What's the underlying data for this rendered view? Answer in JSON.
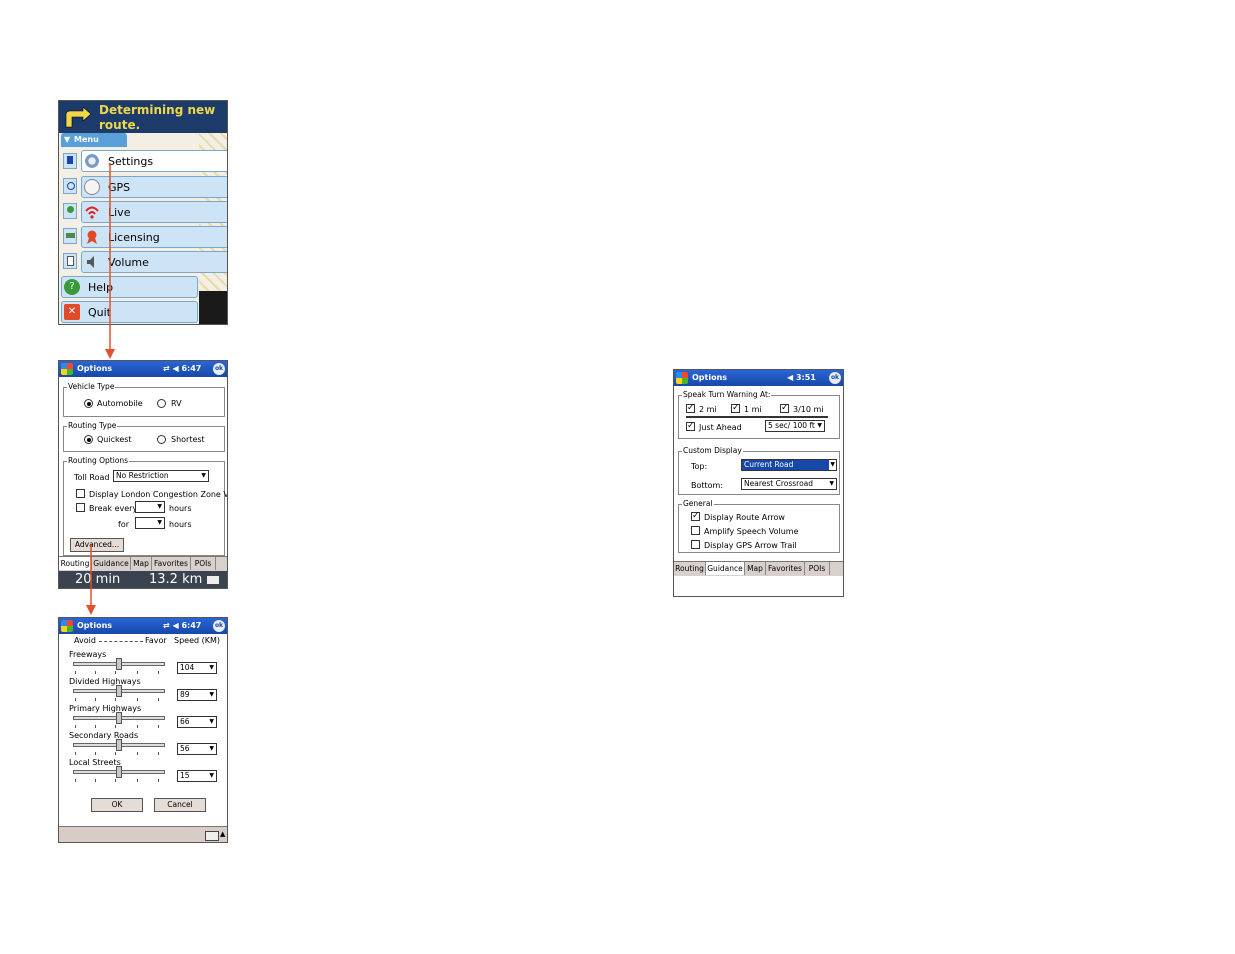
{
  "nav_screen": {
    "banner_text": "Determining new route.",
    "menu_label": "Menu",
    "items": [
      "Settings",
      "GPS",
      "Live",
      "Licensing",
      "Volume",
      "Help",
      "Quit"
    ]
  },
  "routing_options": {
    "title": "Options",
    "time": "6:47",
    "ok_label": "ok",
    "vehicle_group": "Vehicle Type",
    "vehicle_automobile": "Automobile",
    "vehicle_rv": "RV",
    "routing_group": "Routing Type",
    "routing_quickest": "Quickest",
    "routing_shortest": "Shortest",
    "options_group": "Routing Options",
    "toll_label": "Toll Road",
    "toll_value": "No Restriction",
    "congestion_label": "Display London Congestion Zone V",
    "break_label": "Break every",
    "hours1": "hours",
    "for_label": "for",
    "hours2": "hours",
    "advanced_button": "Advanced...",
    "tabs": [
      "Routing",
      "Guidance",
      "Map",
      "Favorites",
      "POIs"
    ],
    "eta_time": "20 min",
    "eta_dist": "13.2 km"
  },
  "advanced": {
    "title": "Options",
    "time": "6:47",
    "ok_label": "ok",
    "header_avoid": "Avoid",
    "header_favor": "Favor",
    "header_speed": "Speed (KM)",
    "roads": [
      {
        "name": "Freeways",
        "speed": "104"
      },
      {
        "name": "Divided Highways",
        "speed": "89"
      },
      {
        "name": "Primary Highways",
        "speed": "66"
      },
      {
        "name": "Secondary Roads",
        "speed": "56"
      },
      {
        "name": "Local Streets",
        "speed": "15"
      }
    ],
    "ok_button": "OK",
    "cancel_button": "Cancel"
  },
  "guidance": {
    "title": "Options",
    "time": "3:51",
    "ok_label": "ok",
    "speak_group": "Speak Turn Warning At:",
    "opt_2mi": "2 mi",
    "opt_1mi": "1 mi",
    "opt_310mi": "3/10 mi",
    "opt_just_ahead": "Just Ahead",
    "just_ahead_value": "5 sec/ 100 ft",
    "custom_group": "Custom Display",
    "top_label": "Top:",
    "top_value": "Current Road",
    "bottom_label": "Bottom:",
    "bottom_value": "Nearest Crossroad",
    "general_group": "General",
    "opt_route_arrow": "Display Route Arrow",
    "opt_amplify": "Amplify Speech Volume",
    "opt_gps_trail": "Display GPS Arrow Trail",
    "tabs": [
      "Routing",
      "Guidance",
      "Map",
      "Favorites",
      "POIs"
    ]
  },
  "colors": {
    "arrow": "#e0522a",
    "titlebar": "#1747a8",
    "menu": "#cce4f6"
  }
}
